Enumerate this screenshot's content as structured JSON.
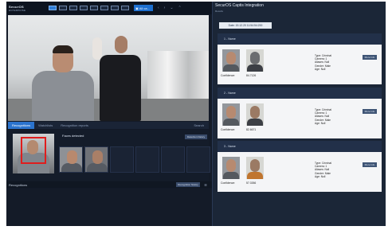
{
  "app": {
    "logo_line1": "SecurOS",
    "logo_line2": "ENTERPRISE"
  },
  "toolbar": {
    "layouts": [
      "layout-1x1",
      "layout-2x2",
      "layout-3x3",
      "layout-4x4",
      "layout-1+5",
      "layout-1+7",
      "layout-3+4",
      "layout-5x5"
    ],
    "camera_select": "All ca...",
    "icons": [
      "chevron-left-icon",
      "chevron-right-icon",
      "chevron-down-icon",
      "chevron-up-icon"
    ]
  },
  "tabs": {
    "items": [
      "Recognitions",
      "Watchlists",
      "Recognition reports"
    ],
    "active": "Recognitions",
    "search": "Search"
  },
  "faces": {
    "title": "Faces detected",
    "history_button": "Detection history"
  },
  "recognitions_bar": {
    "label": "Recognitions",
    "button": "Recognition history"
  },
  "right_panel": {
    "title": "SecurOS Captis Integration",
    "subtitle": "Results",
    "date": "Date: 15.12.20 11:54:54:200",
    "more_label": "More Info",
    "confidence_label": "Confidence:",
    "results": [
      {
        "header": "1 - Name",
        "score": "84.7126",
        "type": "Type: Criminal",
        "camera": "Camera: 1",
        "aliases": "Aliases: Null",
        "gender": "Gender: Male",
        "age": "Age: Null"
      },
      {
        "header": "2 - Name",
        "score": "82.6671",
        "type": "Type: Criminal",
        "camera": "Camera: 1",
        "aliases": "Aliases: Null",
        "gender": "Gender: Male",
        "age": "Age: Null"
      },
      {
        "header": "3 - Name",
        "score": "57.0266",
        "type": "Type: Criminal",
        "camera": "Camera: 1",
        "aliases": "Aliases: Null",
        "gender": "Gender: Male",
        "age": "Age: Null"
      }
    ]
  },
  "colors": {
    "accent": "#2b73cd",
    "background": "#131a27",
    "detection_box": "#e01d1d"
  }
}
